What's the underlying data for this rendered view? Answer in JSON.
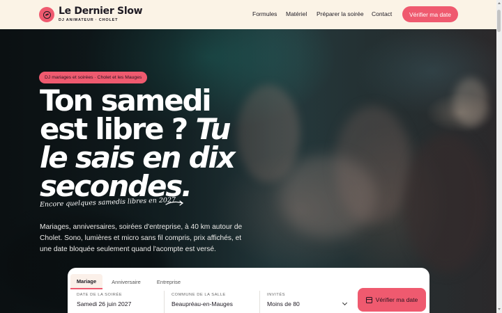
{
  "header": {
    "brand": "Le Dernier Slow",
    "tagline": "DJ ANIMATEUR · CHOLET",
    "nav": [
      "Formules",
      "Matériel",
      "Préparer la soirée",
      "Contact"
    ],
    "cta": "Vérifier ma date"
  },
  "hero": {
    "badge": "DJ mariages et soirées · Cholet et les Mauges",
    "headline_line1": "Ton samedi",
    "headline_line2_plain": "est libre ?",
    "headline_line2_italic": "Tu",
    "headline_line3": "le sais en dix",
    "headline_line4": "secondes.",
    "note": "Encore quelques samedis libres en 2027",
    "intro": "Mariages, anniversaires, soirées d'entreprise, à 40 km autour de Cholet. Sono, lumières et micro sans fil compris, prix affichés, et une date bloquée seulement quand l'acompte est versé."
  },
  "booking": {
    "tabs": [
      "Mariage",
      "Anniversaire",
      "Entreprise"
    ],
    "active_tab": "Mariage",
    "date_label": "DATE DE LA SOIRÉE",
    "date_value": "Samedi 26 juin 2027",
    "commune_label": "COMMUNE DE LA SALLE",
    "commune_value": "Beaupréau-en-Mauges",
    "guests_label": "INVITÉS",
    "guests_value": "Moins de 80",
    "submit": "Vérifier ma date"
  },
  "colors": {
    "accent": "#ef5a6f",
    "header_bg": "#fbf3e6",
    "text_dark": "#1e1a23"
  },
  "icons": {
    "logo": "vinyl-record-icon",
    "note_arrow": "curved-arrow-icon",
    "calendar": "calendar-icon",
    "dropdown": "chevron-down-icon"
  }
}
